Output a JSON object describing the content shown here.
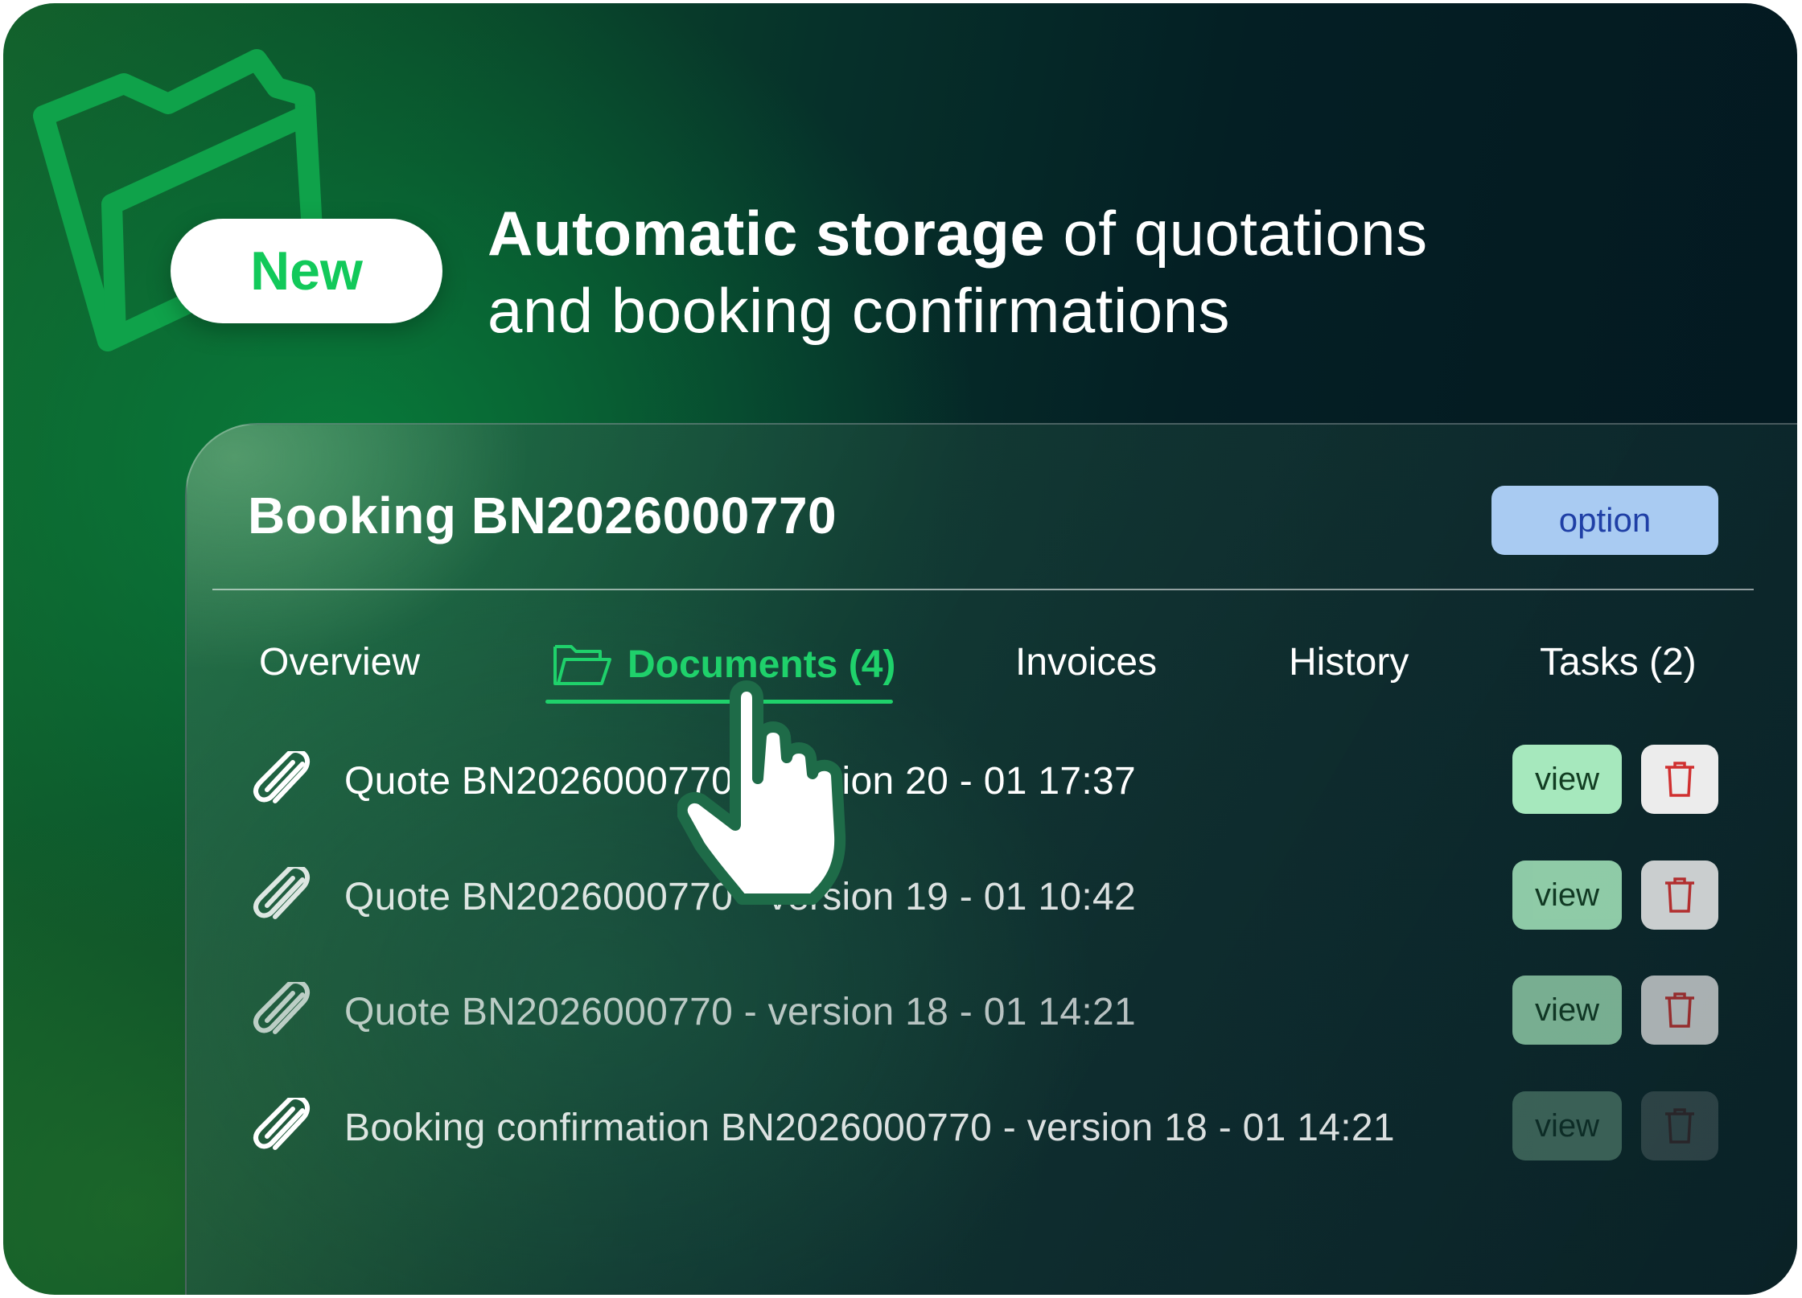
{
  "badge": {
    "label": "New"
  },
  "headline": {
    "bold": "Automatic storage",
    "rest_line1": " of quotations",
    "line2": "and booking confirmations"
  },
  "booking": {
    "title": "Booking BN2026000770",
    "status_button": "option"
  },
  "tabs": [
    {
      "label": "Overview",
      "active": false
    },
    {
      "label": "Documents (4)",
      "active": true,
      "icon": "folder-open-icon"
    },
    {
      "label": "Invoices",
      "active": false
    },
    {
      "label": "History",
      "active": false
    },
    {
      "label": "Tasks (2)",
      "active": false
    }
  ],
  "documents": [
    {
      "name": "Quote BN2026000770 - version 20 - 01 17:37",
      "view_label": "view"
    },
    {
      "name": "Quote BN2026000770 - version 19 - 01 10:42",
      "view_label": "view"
    },
    {
      "name": "Quote BN2026000770 - version 18 - 01 14:21",
      "view_label": "view"
    },
    {
      "name": "Booking confirmation BN2026000770 - version 18 - 01 14:21",
      "view_label": "view"
    }
  ],
  "colors": {
    "accent_green": "#1fd16b",
    "option_bg": "#a9cbf2",
    "option_text": "#1f3fa6",
    "view_bg": "#a6e8bd",
    "trash_icon": "#d03030"
  }
}
